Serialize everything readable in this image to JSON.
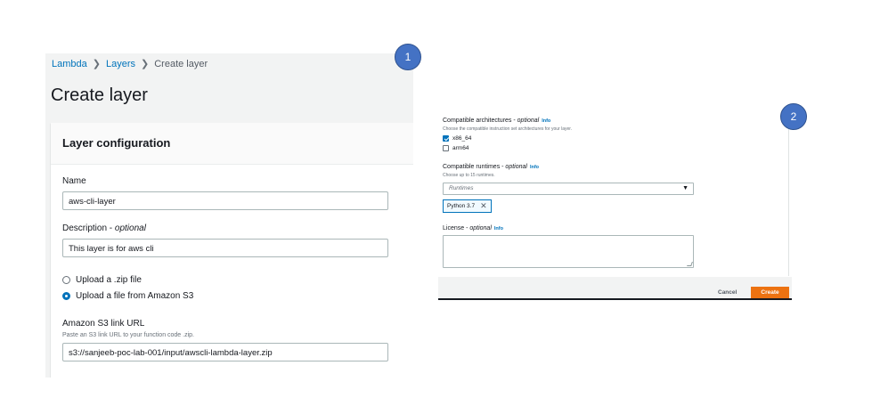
{
  "badges": {
    "one": "1",
    "two": "2"
  },
  "breadcrumb": {
    "lambda": "Lambda",
    "layers": "Layers",
    "current": "Create layer",
    "separator": "›"
  },
  "page_title": "Create layer",
  "layer_configuration": {
    "heading": "Layer configuration",
    "name_label": "Name",
    "name_value": "aws-cli-layer",
    "description_label": "Description - ",
    "description_optional": "optional",
    "description_value": "This layer is for aws cli",
    "upload_zip_label": "Upload a .zip file",
    "upload_s3_label": "Upload a file from Amazon S3",
    "s3_url_label": "Amazon S3 link URL",
    "s3_url_hint": "Paste an S3 link URL to your function code .zip.",
    "s3_url_value": "s3://sanjeeb-poc-lab-001/input/awscli-lambda-layer.zip"
  },
  "panel2": {
    "architectures_label": "Compatible architectures - ",
    "architectures_optional": "optional",
    "info": "Info",
    "architectures_hint": "Choose the compatible instruction set architectures for your layer.",
    "arch_x86": "x86_64",
    "arch_arm": "arm64",
    "runtimes_label": "Compatible runtimes - ",
    "runtimes_optional": "optional",
    "runtimes_hint": "Choose up to 15 runtimes.",
    "runtimes_placeholder": "Runtimes",
    "runtime_token": "Python 3.7",
    "license_label": "License - ",
    "license_optional": "optional",
    "cancel": "Cancel",
    "create": "Create"
  },
  "colors": {
    "accent": "#0073bb",
    "primary_button": "#ec7211",
    "badge": "#4472c4"
  }
}
